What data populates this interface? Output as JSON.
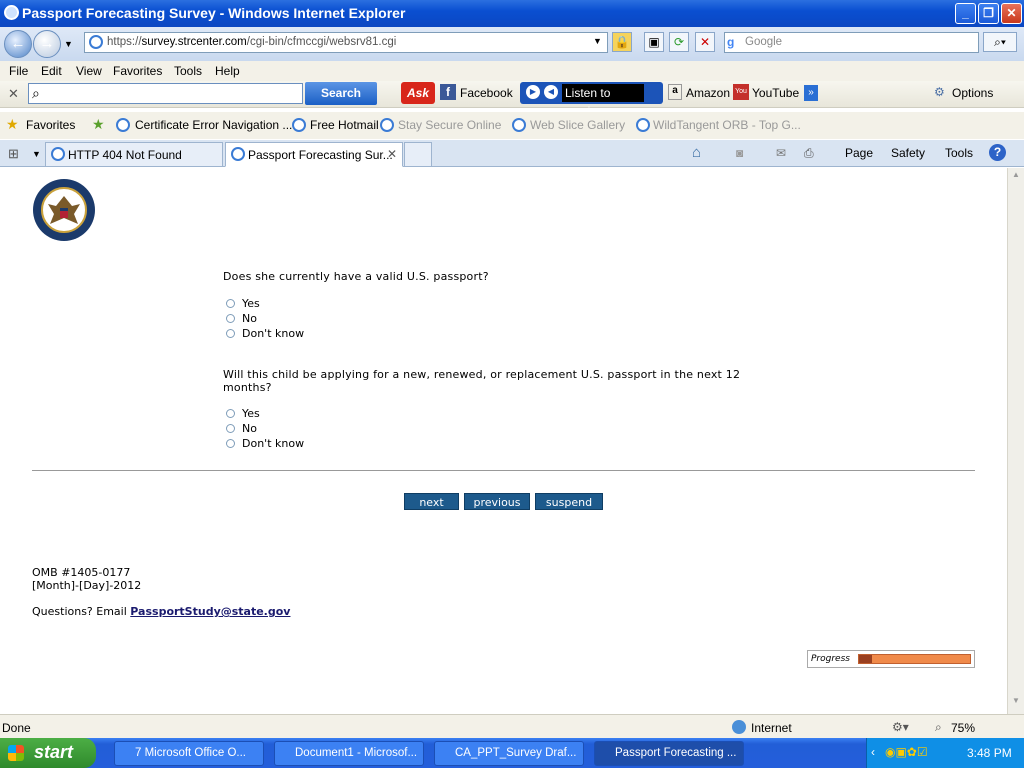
{
  "window": {
    "title": "Passport Forecasting Survey - Windows Internet Explorer"
  },
  "address": {
    "scheme": "https://",
    "host": "survey.strcenter.com",
    "path": "/cgi-bin/cfmccgi/websrv81.cgi",
    "search_placeholder": "Google"
  },
  "menu": [
    "File",
    "Edit",
    "View",
    "Favorites",
    "Tools",
    "Help"
  ],
  "toolbar": {
    "search_label": "Search",
    "ask": "Ask",
    "facebook": "Facebook",
    "music": "Listen to music",
    "amazon": "Amazon",
    "youtube": "YouTube",
    "options": "Options"
  },
  "favorites": {
    "label": "Favorites",
    "items": [
      "Certificate Error Navigation ...",
      "Free Hotmail",
      "Stay Secure Online",
      "Web Slice Gallery",
      "WildTangent ORB - Top G..."
    ]
  },
  "tabs": [
    {
      "label": "HTTP 404 Not Found"
    },
    {
      "label": "Passport Forecasting Sur..."
    }
  ],
  "commands": [
    "Page",
    "Safety",
    "Tools"
  ],
  "survey": {
    "q1": "Does she currently have a valid U.S. passport?",
    "q1_options": [
      "Yes",
      "No",
      "Don't know"
    ],
    "q2": "Will this child be applying for a new, renewed, or replacement U.S. passport in the next 12 months?",
    "q2_options": [
      "Yes",
      "No",
      "Don't know"
    ],
    "buttons": {
      "next": "next",
      "previous": "previous",
      "suspend": "suspend"
    },
    "omb": "OMB #1405-0177",
    "date": "[Month]-[Day]-2012",
    "questions": "Questions? Email ",
    "email": "PassportStudy@state.gov",
    "progress_label": "Progress",
    "progress_fraction": 0.12
  },
  "status": {
    "text": "Done",
    "zone": "Internet",
    "zoom": "75%"
  },
  "taskbar": {
    "start": "start",
    "items": [
      "7 Microsoft Office O...",
      "Document1 - Microsof...",
      "CA_PPT_Survey Draf...",
      "Passport Forecasting ..."
    ],
    "clock": "3:48 PM"
  }
}
